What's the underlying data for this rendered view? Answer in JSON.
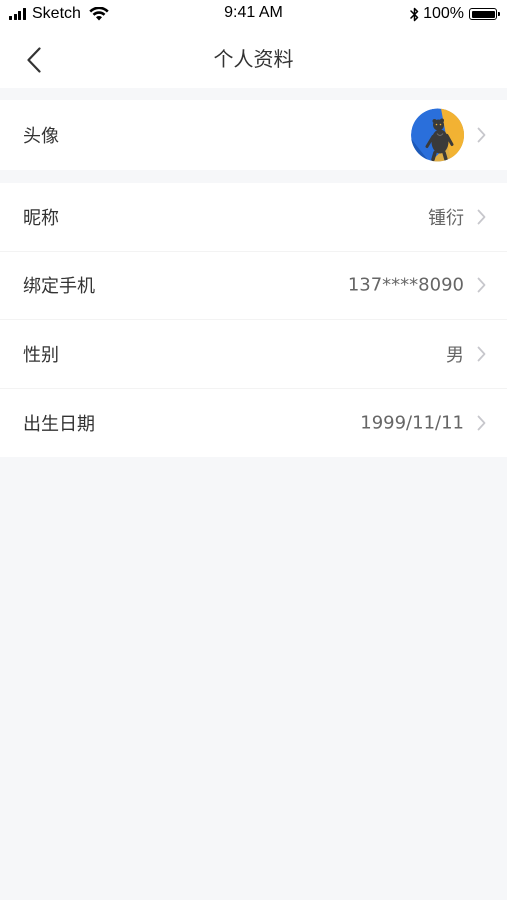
{
  "status_bar": {
    "carrier": "Sketch",
    "time": "9:41 AM",
    "battery": "100%"
  },
  "nav": {
    "title": "个人资料",
    "back_icon": "chevron-left-icon"
  },
  "profile": {
    "avatar_label": "头像",
    "rows": [
      {
        "label": "昵称",
        "value": "锺衍"
      },
      {
        "label": "绑定手机",
        "value": "137****8090"
      },
      {
        "label": "性别",
        "value": "男"
      },
      {
        "label": "出生日期",
        "value": "1999/11/11"
      }
    ]
  },
  "colors": {
    "background": "#f6f7f9",
    "card": "#ffffff",
    "label_text": "#333333",
    "value_text": "#666666",
    "chevron": "#c7c7cc",
    "avatar_blue": "#2a6fdb",
    "avatar_yellow": "#f2b233"
  }
}
